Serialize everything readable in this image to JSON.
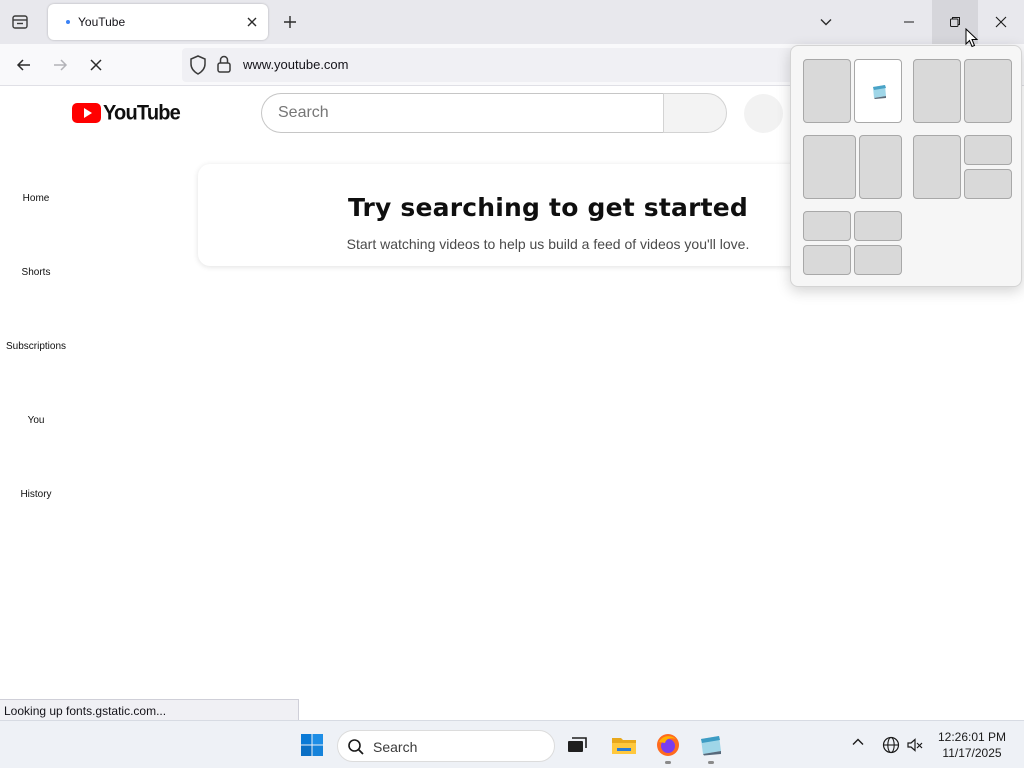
{
  "browser": {
    "tab": {
      "title": "YouTube"
    },
    "url": "www.youtube.com",
    "status_text": "Looking up fonts.gstatic.com..."
  },
  "youtube": {
    "logo_text": "YouTube",
    "search": {
      "placeholder": "Search"
    },
    "sidebar": [
      {
        "label": "Home"
      },
      {
        "label": "Shorts"
      },
      {
        "label": "Subscriptions"
      },
      {
        "label": "You"
      },
      {
        "label": "History"
      }
    ],
    "card": {
      "title": "Try searching to get started",
      "subtitle": "Start watching videos to help us build a feed of videos you'll love."
    }
  },
  "taskbar": {
    "search_label": "Search",
    "clock": {
      "time": "12:26:01 PM",
      "date": "11/17/2025"
    }
  },
  "colors": {
    "youtube_red": "#ff0000",
    "tab_loading": "#3b82f6",
    "windows_blue": "#0078d4"
  }
}
